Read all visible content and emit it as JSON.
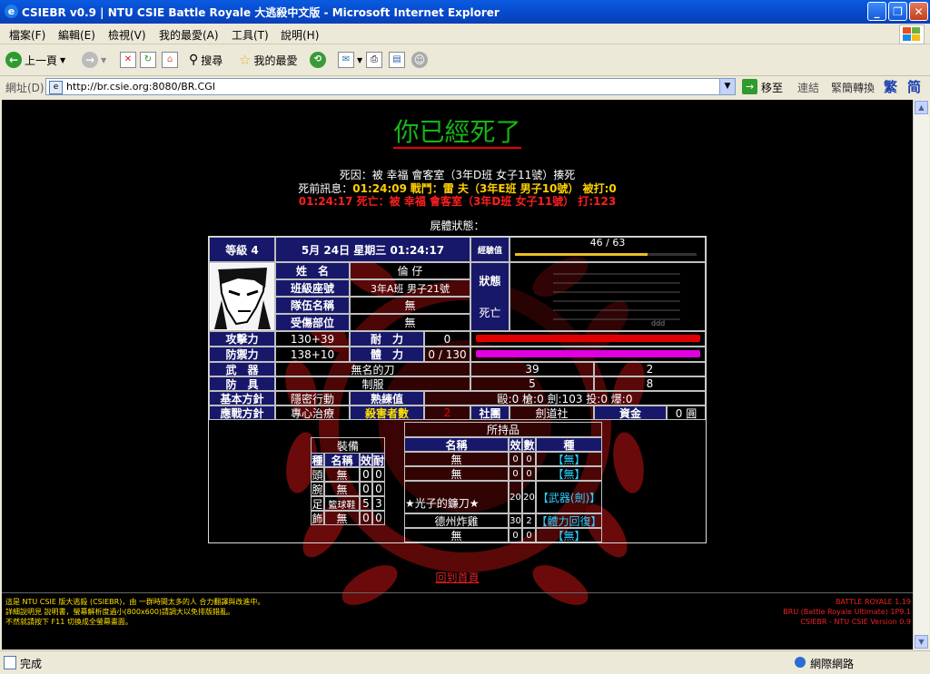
{
  "window": {
    "title": "CSIEBR v0.9 | NTU CSIE Battle Royale 大逃殺中文版 - Microsoft Internet Explorer"
  },
  "menu": [
    "檔案(F)",
    "編輯(E)",
    "檢視(V)",
    "我的最愛(A)",
    "工具(T)",
    "說明(H)"
  ],
  "toolbar": {
    "back": "上一頁",
    "search": "搜尋",
    "favorites": "我的最愛"
  },
  "address": {
    "label": "網址(D)",
    "url": "http://br.csie.org:8080/BR.CGI",
    "go": "移至",
    "links": "連結",
    "convert": "緊簡轉換",
    "trad": "繁",
    "simp": "简"
  },
  "page": {
    "dead_title": "你已經死了",
    "death_cause": "死因：被 幸福 會客室（3年D班 女子11號）揍死",
    "last_msg_label": "死前訊息：",
    "last_msg_time": "01:24:09",
    "last_msg_text": "戰鬥：雷 夫（3年E班 男子10號） 被打:0",
    "death_line": "01:24:17 死亡：被 幸福 會客室（3年D班 女子11號） 打:123",
    "corpse_status": "屍體狀態："
  },
  "status": {
    "level": "等級 4",
    "datetime": "5月 24日 星期三 01:24:17",
    "exp_label": "經驗值",
    "exp_value": "46 / 63",
    "exp_fraction": 0.73,
    "name_label": "姓　名",
    "name": "倫 仔",
    "class_label": "班級座號",
    "class": "3年A班 男子21號",
    "team_label": "隊伍名稱",
    "team": "無",
    "injury_label": "受傷部位",
    "injury": "無",
    "state_label": "狀態",
    "state": "死亡",
    "att_label": "攻擊力",
    "att": "130+39",
    "def_label": "防禦力",
    "def": "138+10",
    "dur_label": "耐　力",
    "dur": "0",
    "hp_label": "體　力",
    "hp": "0 / 130",
    "weapon_label": "武　器",
    "weapon": "無名的刀",
    "weapon_e": "39",
    "weapon_n": "2",
    "armor_label": "防　具",
    "armor": "制服",
    "armor_e": "5",
    "armor_n": "8",
    "policy_label": "基本方針",
    "policy": "隱密行動",
    "skill_label": "熟練值",
    "skill": "毆:0 槍:0 劍:103 投:0 爆:0",
    "battle_label": "應戰方針",
    "battle": "專心治療",
    "kills_label": "殺害者數",
    "kills": "2",
    "club_label": "社團",
    "club": "劍道社",
    "money_label": "資金",
    "money": "0 圓"
  },
  "equip": {
    "title": "裝備",
    "headers": [
      "種",
      "名稱",
      "效",
      "耐"
    ],
    "rows": [
      [
        "頭",
        "無",
        "0",
        "0"
      ],
      [
        "腕",
        "無",
        "0",
        "0"
      ],
      [
        "足",
        "籃球鞋",
        "5",
        "3"
      ],
      [
        "飾",
        "無",
        "0",
        "0"
      ]
    ]
  },
  "items": {
    "title": "所持品",
    "headers": [
      "名稱",
      "效",
      "數",
      "種"
    ],
    "rows": [
      [
        "無",
        "0",
        "0",
        "【無】"
      ],
      [
        "無",
        "0",
        "0",
        "【無】"
      ],
      [
        "★光子的鐮刀★",
        "20",
        "20",
        "【武器(劍)】"
      ],
      [
        "德州炸雞",
        "30",
        "2",
        "【體力回復】"
      ],
      [
        "無",
        "0",
        "0",
        "【無】"
      ]
    ]
  },
  "back_link": "回到首頁",
  "footer_left": [
    "這是 NTU CSIE 版大逃殺 (CSIEBR)，由 一群時間太多的人 合力翻譯與改進中。",
    "詳細說明見 說明書，螢幕解析度過小(800x600)請調大以免排版錯亂。",
    "不然就請按下 F11 切換成全螢幕畫面。"
  ],
  "footer_right": [
    "BATTLE ROYALE 1.19",
    "BRU (Battle Royale Ultimate) 1P9.1",
    "CSIEBR - NTU CSIE Version 0.9"
  ],
  "statusbar": {
    "done": "完成",
    "zone": "網際網路"
  },
  "colors": {
    "title_green": "#16B516",
    "hp_red": "#E00000",
    "sp_magenta": "#E000E0",
    "exp_yellow": "#E8C020"
  }
}
